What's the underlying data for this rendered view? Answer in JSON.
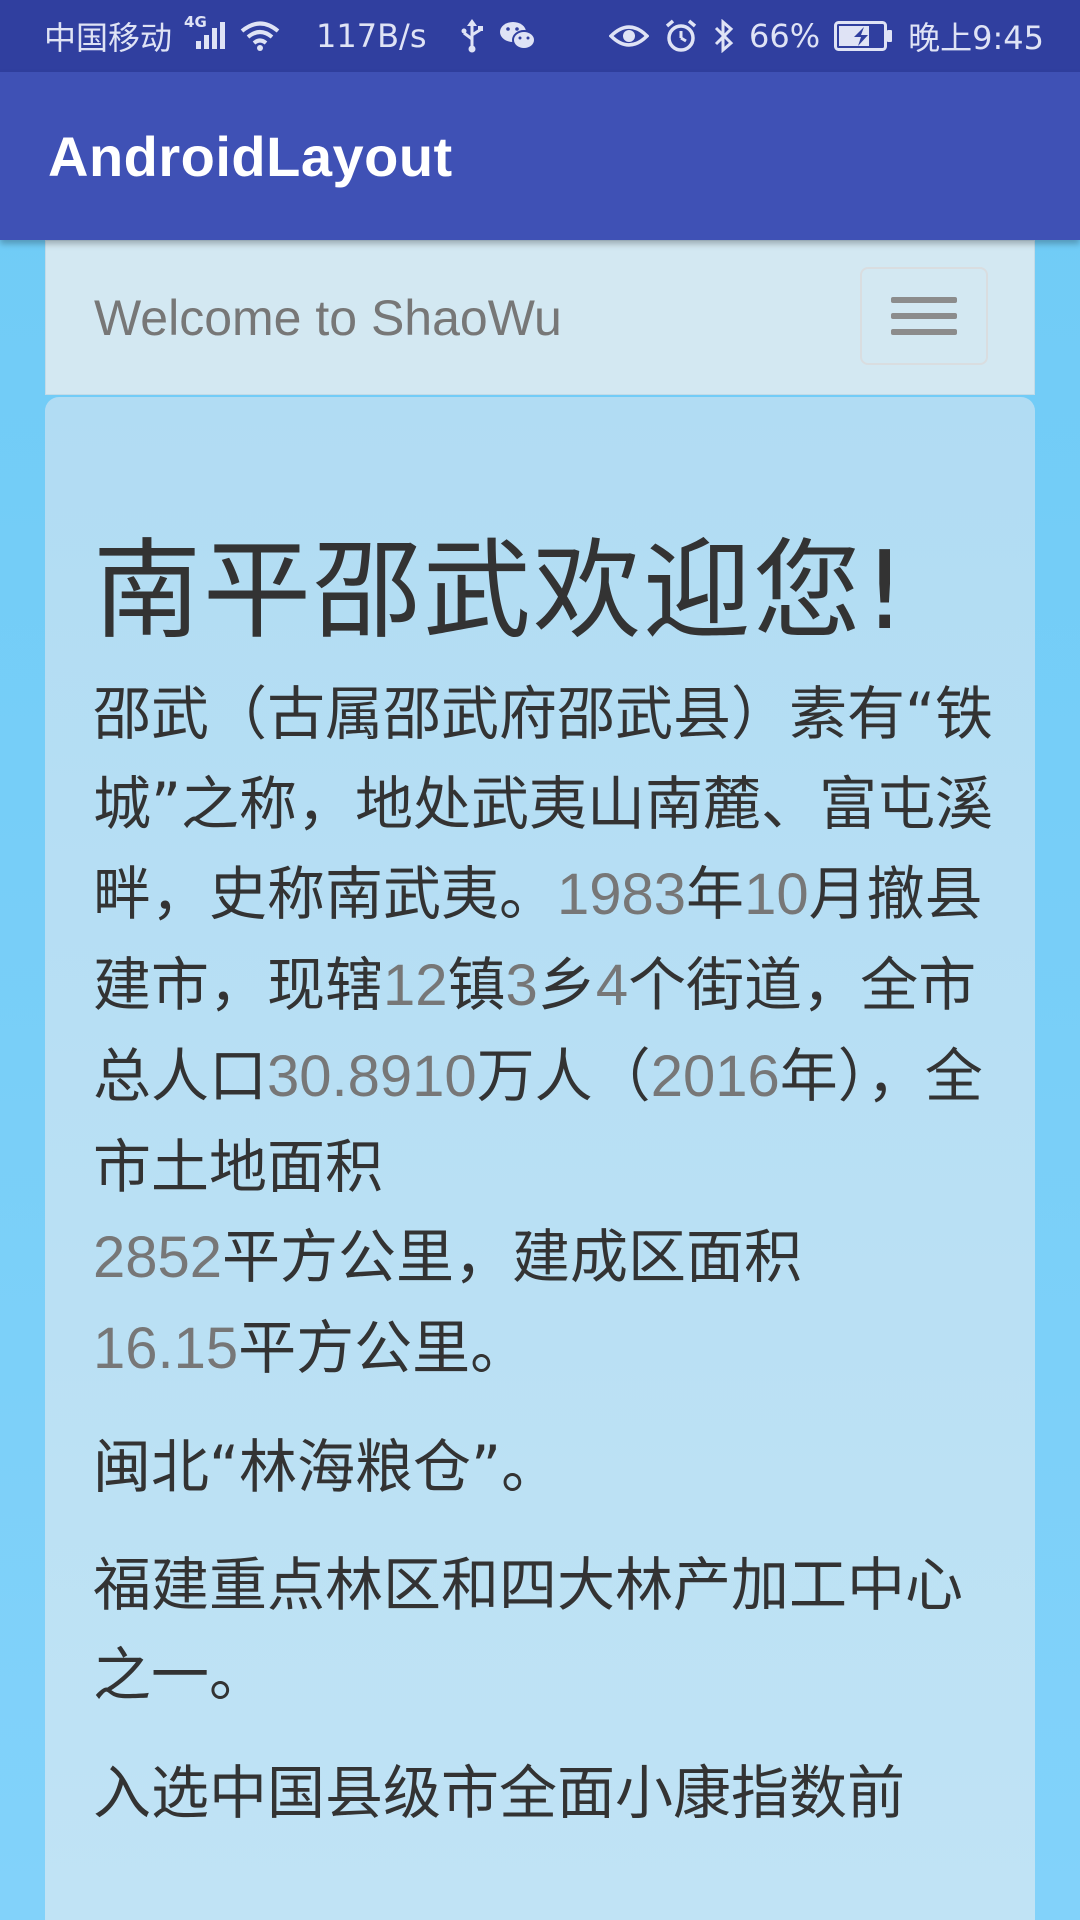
{
  "status_bar": {
    "carrier": "中国移动",
    "network_type": "4G",
    "net_speed": "117B/s",
    "battery_percent": "66%",
    "time": "晚上9:45",
    "icons": [
      "signal-icon",
      "wifi-icon",
      "usb-icon",
      "wechat-icon",
      "eye-icon",
      "alarm-icon",
      "bluetooth-icon",
      "battery-charging-icon"
    ]
  },
  "app_bar": {
    "title": "AndroidLayout"
  },
  "navbar": {
    "brand": "Welcome to ShaoWu",
    "toggle_icon": "hamburger-menu-icon"
  },
  "jumbotron": {
    "title": "南平邵武欢迎您!",
    "intro": {
      "s1": "邵武（古属邵武府邵武县）素有“铁城”之称，地处武夷山南麓、富屯溪畔，史称南武夷。",
      "n1": "1983",
      "s2": "年",
      "n2": "10",
      "s3": "月撤县建市，现辖",
      "n3": "12",
      "s4": "镇",
      "n4": "3",
      "s5": "乡",
      "n5": "4",
      "s6": "个街道，全市总人口",
      "n6": "30.8910",
      "s7": "万人（",
      "n7": "2016",
      "s8": "年），全市土地面积",
      "n8": "2852",
      "s9": "平方公里，建成区面积",
      "n9": "16.15",
      "s10": "平方公里。"
    },
    "para2": "闽北“林海粮仓”。",
    "para3": "福建重点林区和四大林产加工中心之一。",
    "para4": "入选中国县级市全面小康指数前"
  },
  "colors": {
    "status_bar": "#303f9f",
    "app_bar": "#3f51b5",
    "page_background": "#7ccff8",
    "navbar_background": "#d3e8f2",
    "jumbotron_background": "#b6def4",
    "text": "#333333",
    "muted_text": "#777777"
  }
}
